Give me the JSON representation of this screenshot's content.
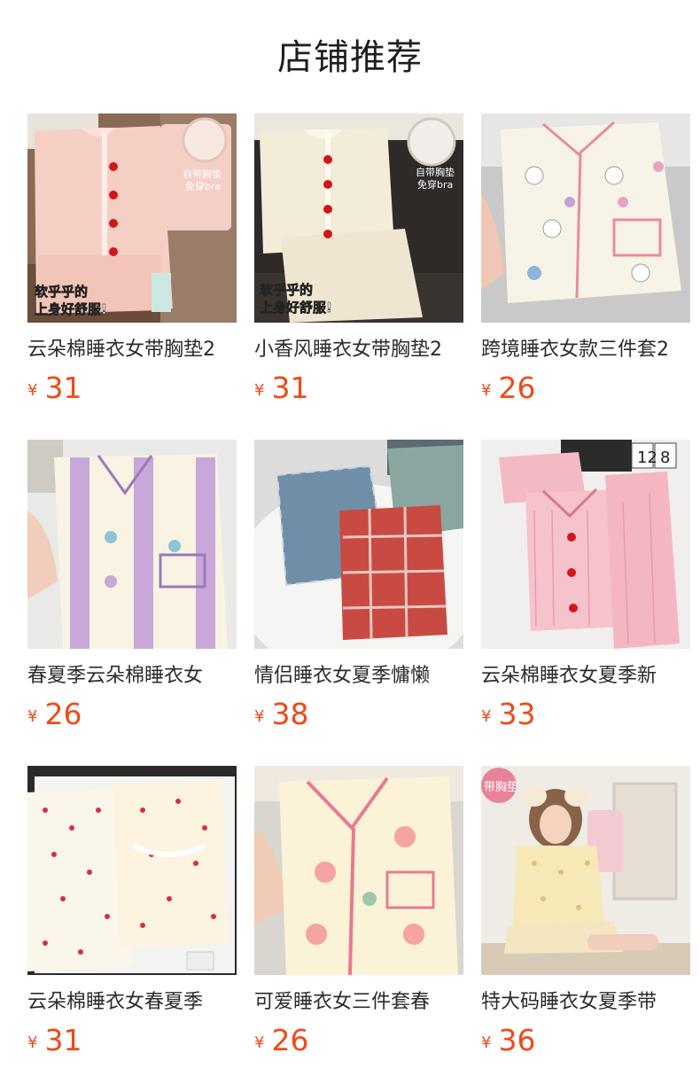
{
  "header": {
    "title": "店铺推荐"
  },
  "products": [
    {
      "title": "云朵棉睡衣女带胸垫2",
      "currency": "¥",
      "price": "31",
      "photo_text": [
        "自带胸垫",
        "免穿bra",
        "软乎乎的",
        "上身好舒服!"
      ],
      "photo_subject": "pink pajama set with red heart buttons"
    },
    {
      "title": "小香风睡衣女带胸垫2",
      "currency": "¥",
      "price": "31",
      "photo_text": [
        "自带胸垫",
        "免穿bra",
        "软乎乎的",
        "上身好舒服!"
      ],
      "photo_subject": "cream pajama set with red heart buttons"
    },
    {
      "title": "跨境睡衣女款三件套2",
      "currency": "¥",
      "price": "26",
      "photo_text": [],
      "photo_subject": "white pajama shirt with cartoon character print"
    },
    {
      "title": "春夏季云朵棉睡衣女",
      "currency": "¥",
      "price": "26",
      "photo_text": [],
      "photo_subject": "purple striped floral pajama shirt"
    },
    {
      "title": "情侣睡衣女夏季慵懒",
      "currency": "¥",
      "price": "38",
      "photo_text": [],
      "photo_subject": "blue and red plaid couple pajamas"
    },
    {
      "title": "云朵棉睡衣女夏季新",
      "currency": "¥",
      "price": "33",
      "photo_text": [
        "12",
        "8"
      ],
      "photo_subject": "pink striped pajama set"
    },
    {
      "title": "云朵棉睡衣女春夏季",
      "currency": "¥",
      "price": "31",
      "photo_text": [],
      "photo_subject": "cherry print pajamas in gift box"
    },
    {
      "title": "可爱睡衣女三件套春",
      "currency": "¥",
      "price": "26",
      "photo_text": [],
      "photo_subject": "cream pajama shirt with pink trim and peach print"
    },
    {
      "title": "特大码睡衣女夏季带",
      "currency": "¥",
      "price": "36",
      "photo_text": [
        "带胸垫"
      ],
      "photo_subject": "model wearing yellow floral short pajama set"
    }
  ],
  "colors": {
    "price": "#f04a18",
    "title": "#2b2b2b"
  }
}
